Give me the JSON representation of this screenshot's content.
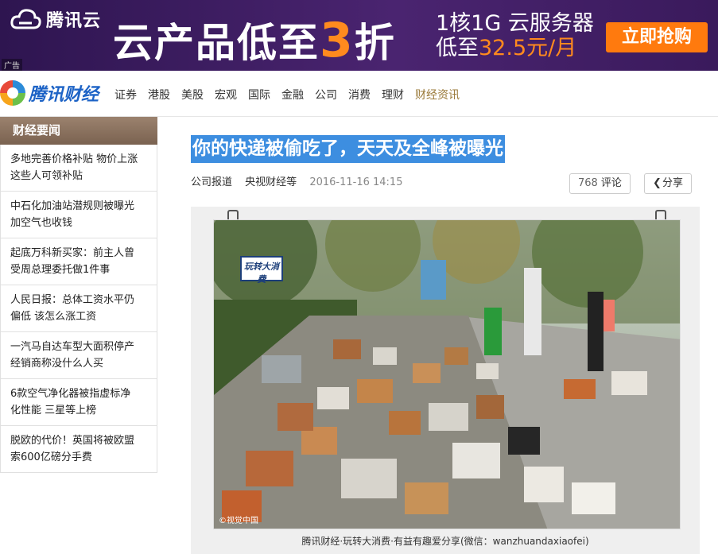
{
  "ad": {
    "logo_text": "腾讯云",
    "headline_prefix": "云产品低至",
    "headline_num": "3",
    "headline_suffix": "折",
    "sub_line1": "1核1G 云服务器",
    "sub_line2_prefix": "低至",
    "sub_line2_price": "32.5元/月",
    "cta": "立即抢购",
    "tag": "广告",
    "colors": {
      "background": "#3a1a5c",
      "accent": "#ff7a0e"
    }
  },
  "nav": {
    "brand": "腾讯财经",
    "items": [
      "证券",
      "港股",
      "美股",
      "宏观",
      "国际",
      "金融",
      "公司",
      "消费",
      "理财",
      "财经资讯"
    ],
    "active_index": 9
  },
  "sidebar": {
    "title": "财经要闻",
    "items": [
      {
        "line1": "多地完善价格补贴 物价上涨",
        "line2": "这些人可领补贴"
      },
      {
        "line1": "中石化加油站潜规则被曝光",
        "line2": "加空气也收钱"
      },
      {
        "line1": "起底万科新买家：前主人曾",
        "line2": "受周总理委托做1件事"
      },
      {
        "line1": "人民日报：总体工资水平仍",
        "line2": "偏低 该怎么涨工资"
      },
      {
        "line1": "一汽马自达车型大面积停产",
        "line2": "经销商称没什么人买"
      },
      {
        "line1": "6款空气净化器被指虚标净",
        "line2": "化性能 三星等上榜"
      },
      {
        "line1": "脱欧的代价！英国将被欧盟",
        "line2": "索600亿磅分手费"
      }
    ]
  },
  "article": {
    "title": "你的快递被偷吃了，天天及全峰被曝光",
    "source1": "公司报道",
    "source2": "央视财经等",
    "date": "2016-11-16 14:15",
    "comment_count": "768",
    "comment_label": "评论",
    "share_label": "分享",
    "photo_watermark": "玩转大消费",
    "photo_credit": "©视觉中国",
    "caption": "腾讯财经·玩转大消费·有益有趣爱分享(微信：wanzhuandaxiaofei)"
  }
}
